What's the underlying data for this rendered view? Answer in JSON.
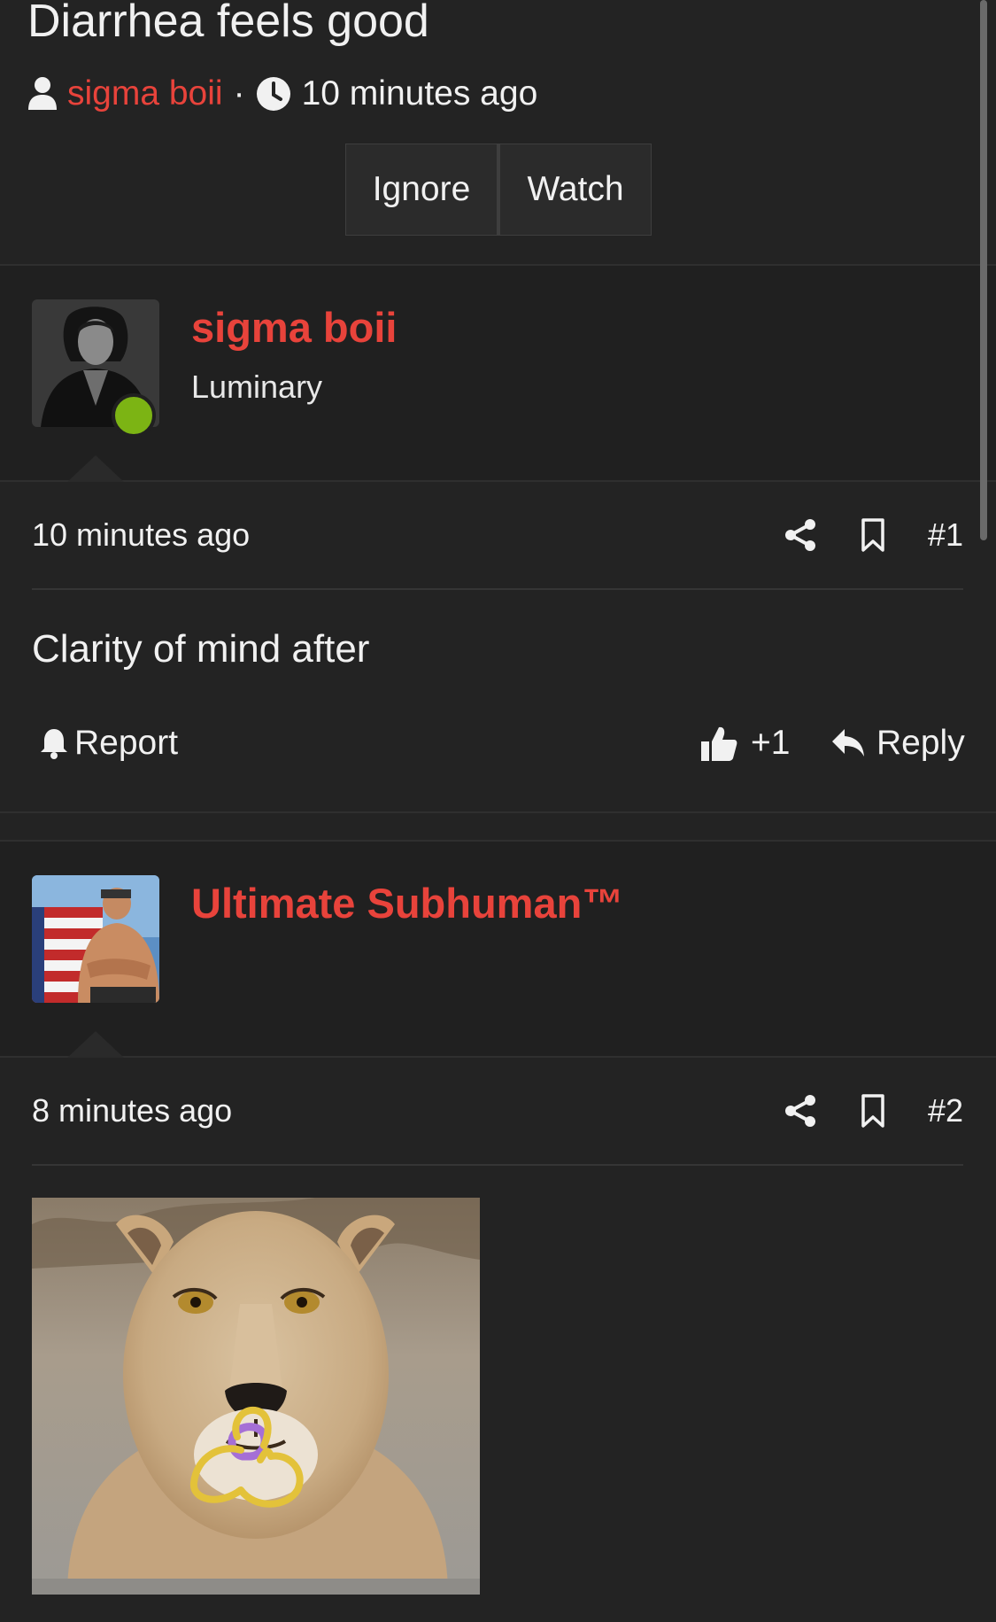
{
  "thread": {
    "title": "Diarrhea feels good",
    "author": "sigma boii",
    "separator": "·",
    "time": "10 minutes ago",
    "buttons": {
      "ignore": "Ignore",
      "watch": "Watch"
    }
  },
  "posts": [
    {
      "username": "sigma boii",
      "user_title": "Luminary",
      "online": true,
      "time": "10 minutes ago",
      "number": "#1",
      "body": "Clarity of mind after",
      "actions": {
        "report": "Report",
        "reaction": "+1",
        "reply": "Reply"
      }
    },
    {
      "username": "Ultimate Subhuman™",
      "user_title": "",
      "online": false,
      "time": "8 minutes ago",
      "number": "#2",
      "image": "lioness-photo-with-doodle"
    }
  ],
  "icons": {
    "user": "user-icon",
    "clock": "clock-icon",
    "share": "share-icon",
    "bookmark": "bookmark-icon",
    "bell": "bell-icon",
    "thumbs_up": "thumbs-up-icon",
    "reply": "reply-icon"
  },
  "colors": {
    "background": "#232323",
    "accent": "#e8433b",
    "online": "#7cb414",
    "text": "#f1f1f1"
  }
}
